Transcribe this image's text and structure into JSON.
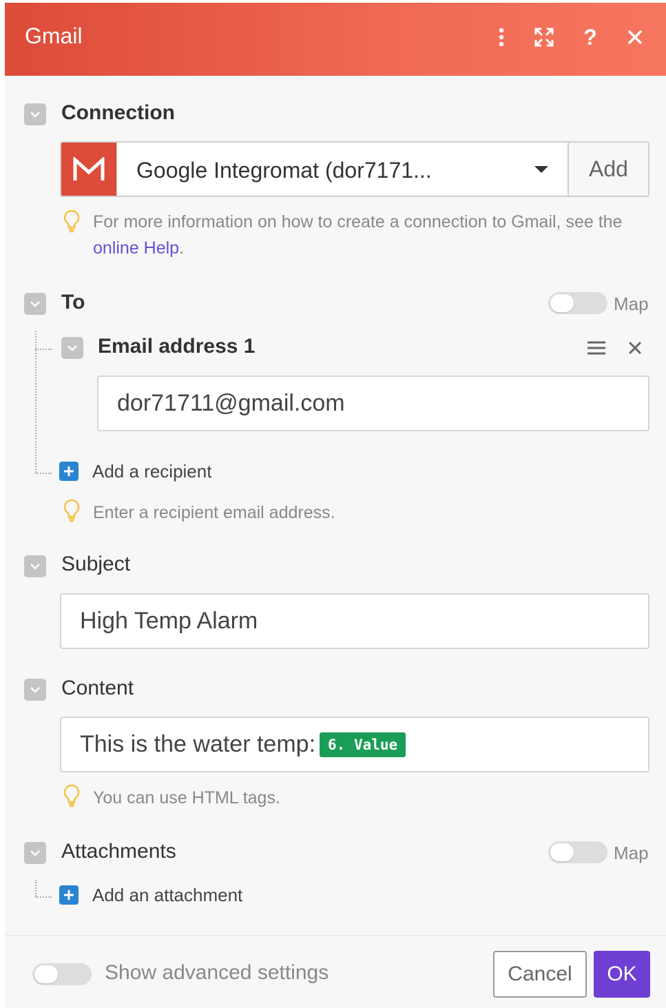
{
  "header": {
    "title": "Gmail",
    "menu_icon": "kebab-menu-icon",
    "expand_icon": "expand-icon",
    "help_icon": "?",
    "close_icon": "close-icon"
  },
  "colors": {
    "header_gradient_start": "#dd4b39",
    "header_gradient_end": "#f7765f",
    "accent_purple": "#6f3fd4",
    "link": "#6b4fd8",
    "plus_blue": "#2a84d2",
    "pill_green": "#1a9e57"
  },
  "connection": {
    "label": "Connection",
    "selected": "Google Integromat (dor7171...",
    "add_label": "Add",
    "hint_prefix": "For more information on how to create a connection to Gmail, see the",
    "hint_link": "online Help",
    "hint_suffix": "."
  },
  "to": {
    "label": "To",
    "map_label": "Map",
    "item_label": "Email address 1",
    "item_value": "dor71711@gmail.com",
    "add_label": "Add a recipient",
    "hint": "Enter a recipient email address."
  },
  "subject": {
    "label": "Subject",
    "value": "High Temp Alarm"
  },
  "content": {
    "label": "Content",
    "text": "This is the water temp:",
    "pill": "6. Value",
    "hint": "You can use HTML tags."
  },
  "attachments": {
    "label": "Attachments",
    "map_label": "Map",
    "add_label": "Add an attachment"
  },
  "footer": {
    "advanced_label": "Show advanced settings",
    "cancel_label": "Cancel",
    "ok_label": "OK"
  }
}
